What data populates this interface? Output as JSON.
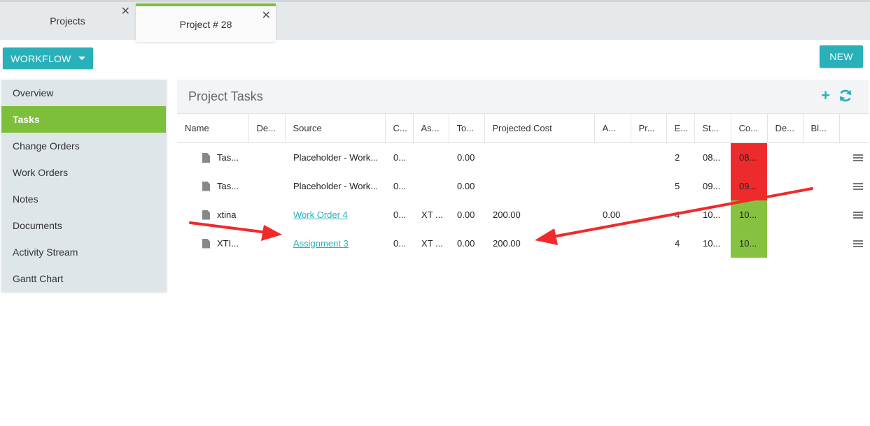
{
  "tabs": [
    {
      "label": "Projects"
    },
    {
      "label": "Project # 28"
    }
  ],
  "toolbar": {
    "workflow_label": "WORKFLOW",
    "new_label": "NEW"
  },
  "sidebar": {
    "items": [
      {
        "label": "Overview"
      },
      {
        "label": "Tasks"
      },
      {
        "label": "Change Orders"
      },
      {
        "label": "Work Orders"
      },
      {
        "label": "Notes"
      },
      {
        "label": "Documents"
      },
      {
        "label": "Activity Stream"
      },
      {
        "label": "Gantt Chart"
      }
    ],
    "active_index": 1
  },
  "panel": {
    "title": "Project Tasks",
    "columns": [
      "Name",
      "De...",
      "Source",
      "C...",
      "As...",
      "To...",
      "Projected Cost",
      "A...",
      "Pr...",
      "E...",
      "St...",
      "Co...",
      "De...",
      "Bl...",
      ""
    ],
    "rows": [
      {
        "name": "Tas...",
        "source": "Placeholder - Work...",
        "c": "0...",
        "as": "",
        "to": "0.00",
        "cost": "",
        "a": "",
        "e": "2",
        "st": "08...",
        "co": "08..."
      },
      {
        "name": "Tas...",
        "source": "Placeholder - Work...",
        "c": "0...",
        "as": "",
        "to": "0.00",
        "cost": "",
        "a": "",
        "e": "5",
        "st": "09...",
        "co": "09..."
      },
      {
        "name": "xtina",
        "source": "Work Order 4",
        "c": "0...",
        "as": "XT ...",
        "to": "0.00",
        "cost": "200.00",
        "a": "0.00",
        "e": "4",
        "st": "10...",
        "co": "10..."
      },
      {
        "name": "XTI...",
        "source": "Assignment 3",
        "c": "0...",
        "as": "XT ...",
        "to": "0.00",
        "cost": "200.00",
        "a": "",
        "e": "4",
        "st": "10...",
        "co": "10..."
      }
    ]
  },
  "colors": {
    "accent": "#29b0b9",
    "active": "#7dbf3b",
    "status_red": "#ee2b2c",
    "status_green": "#86c23f",
    "annotation": "#f02a2a"
  },
  "icons": [
    "close-icon",
    "caret-down-icon",
    "plus-icon",
    "refresh-icon",
    "document-icon",
    "menu-icon"
  ]
}
